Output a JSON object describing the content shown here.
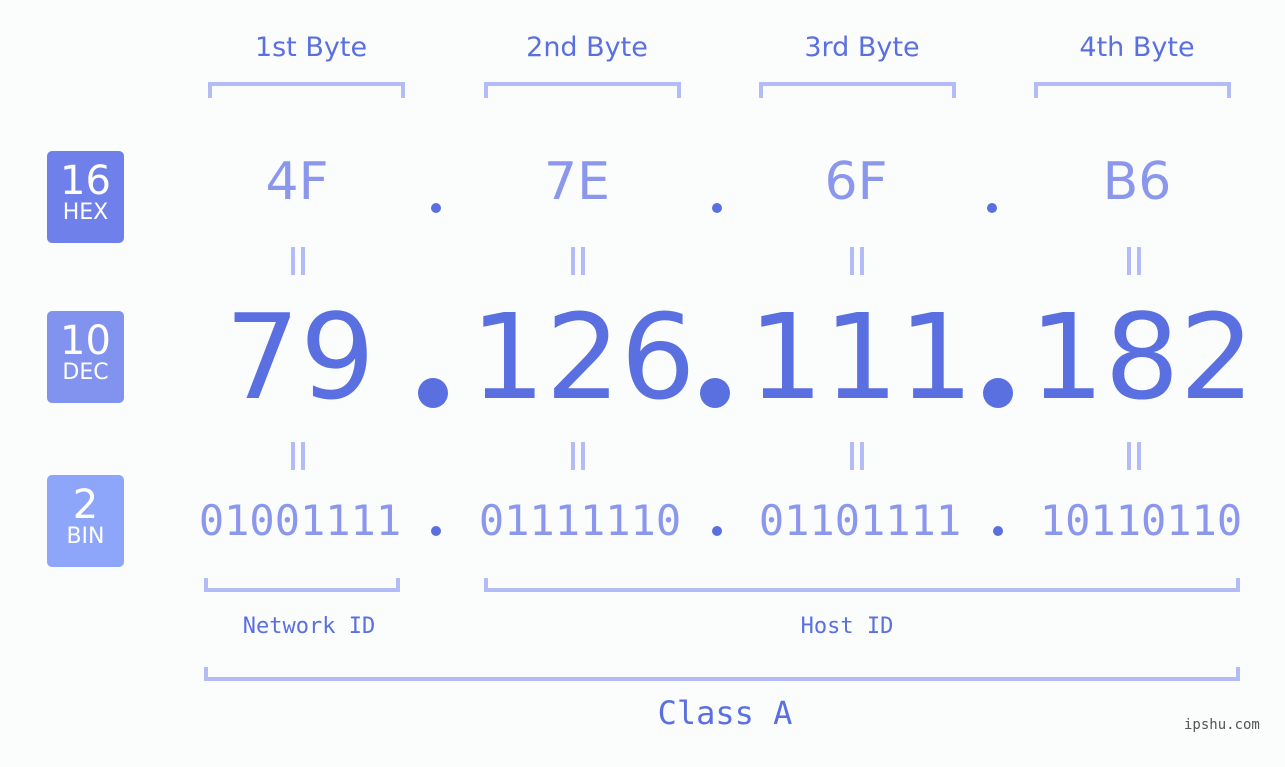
{
  "badges": [
    {
      "base": "16",
      "label": "HEX",
      "color": "#6f80ea"
    },
    {
      "base": "10",
      "label": "DEC",
      "color": "#8192ef"
    },
    {
      "base": "2",
      "label": "BIN",
      "color": "#8ea6fa"
    }
  ],
  "byte_headers": [
    "1st Byte",
    "2nd Byte",
    "3rd Byte",
    "4th Byte"
  ],
  "hex": [
    "4F",
    "7E",
    "6F",
    "B6"
  ],
  "dec": [
    "79",
    "126",
    "111",
    "182"
  ],
  "bin": [
    "01001111",
    "01111110",
    "01101111",
    "10110110"
  ],
  "separator": ".",
  "network_label": "Network ID",
  "host_label": "Host ID",
  "class_label": "Class A",
  "watermark": "ipshu.com"
}
